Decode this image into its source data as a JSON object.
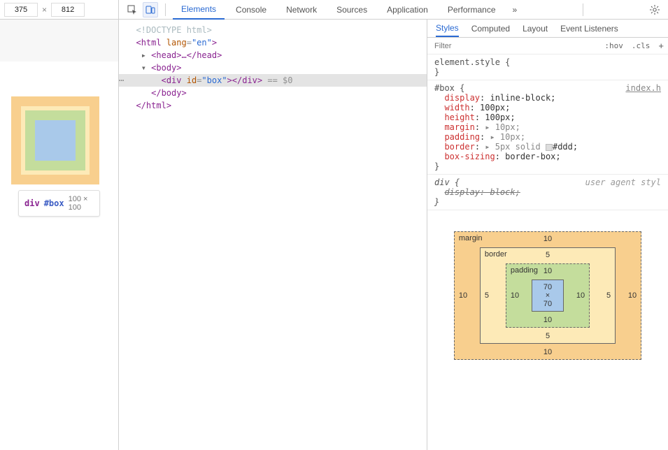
{
  "viewport": {
    "width": "375",
    "height": "812"
  },
  "preview_tooltip": {
    "tag": "div",
    "id": "#box",
    "dim": "100 × 100"
  },
  "top_tabs": [
    "Elements",
    "Console",
    "Network",
    "Sources",
    "Application",
    "Performance"
  ],
  "top_active": 0,
  "more": "»",
  "dom": {
    "l1": "<!DOCTYPE html>",
    "l2_open": "<",
    "l2_tag": "html",
    "l2_attr": " lang",
    "l2_eq": "=",
    "l2_val": "\"en\"",
    "l2_close": ">",
    "l3": "▸ <head>…</head>",
    "l3_open": "<",
    "l3_tag": "head",
    "l3_mid": ">…</",
    "l3_close": ">",
    "l4_arrow": "▾ ",
    "l4_open": "<",
    "l4_tag": "body",
    "l4_close": ">",
    "l5_open": "<",
    "l5_tag": "div",
    "l5_attr": " id",
    "l5_eq": "=",
    "l5_val": "\"box\"",
    "l5_mid": "></",
    "l5_close": ">",
    "l5_end": " == $0",
    "l6_open": "</",
    "l6_tag": "body",
    "l6_close": ">",
    "l7_open": "</",
    "l7_tag": "html",
    "l7_close": ">"
  },
  "style_tabs": [
    "Styles",
    "Computed",
    "Layout",
    "Event Listeners"
  ],
  "style_active": 0,
  "filter_placeholder": "Filter",
  "filter_btns": [
    ":hov",
    ".cls"
  ],
  "rules": {
    "element_style": {
      "selector": "element.style {",
      "close": "}"
    },
    "box_rule": {
      "selector": "#box {",
      "source": "index.h",
      "props": [
        {
          "k": "display",
          "v": "inline-block;"
        },
        {
          "k": "width",
          "v": "100px;"
        },
        {
          "k": "height",
          "v": "100px;"
        },
        {
          "k": "margin",
          "v": "▸ 10px;",
          "tri": true
        },
        {
          "k": "padding",
          "v": "▸ 10px;",
          "tri": true
        },
        {
          "k": "border",
          "v": "▸ 5px solid ",
          "swatch": true,
          "v2": "#ddd;",
          "tri": true
        },
        {
          "k": "box-sizing",
          "v": "border-box;"
        }
      ],
      "close": "}"
    },
    "ua_rule": {
      "selector": "div {",
      "tag": "user agent styl",
      "prop": "display",
      "val": "block;",
      "close": "}"
    }
  },
  "box_model": {
    "margin_label": "margin",
    "border_label": "border",
    "padding_label": "padding",
    "margin": "10",
    "border": "5",
    "padding": "10",
    "content": "70 × 70"
  }
}
